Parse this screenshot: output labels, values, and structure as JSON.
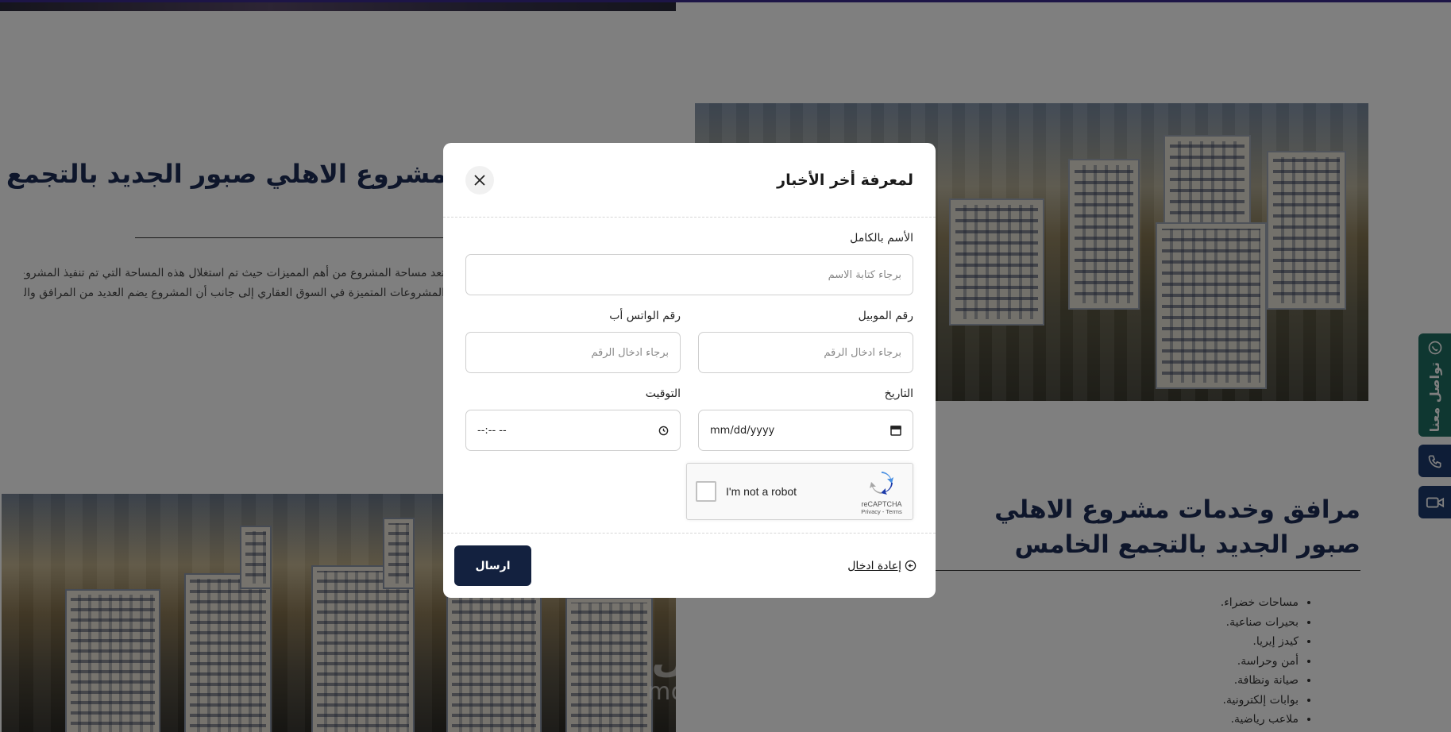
{
  "background": {
    "title_1": "مشروع الاهلي صبور الجديد بالتجمع",
    "paragraph_1_line_1": "تعد مساحة المشروع من أهم المميزات حيث تم استغلال هذه المساحة التي تم تنفيذ المشروع عليها تم استغلالها بطريقة مميزة ليكون المشروع من",
    "paragraph_1_line_2": "المشروعات المتميزة في السوق العقاري إلى جانب أن المشروع يضم العديد من المرافق والخدمات المميزة التي تستطيع من خلالها ضمان",
    "title_2": "مرافق وخدمات مشروع الاهلي صبور الجديد بالتجمع الخامس",
    "amenities": [
      "مساحات خضراء.",
      "بحيرات صناعية.",
      "كيدز إيريا.",
      "أمن وحراسة.",
      "صيانة ونظافة.",
      "بوابات إلكترونية.",
      "ملاعب رياضية."
    ],
    "side_contact_label": "تواصل معنا",
    "watermark_ar": "مستقل",
    "watermark_en": "mostaql.com"
  },
  "modal": {
    "title": "لمعرفة أخر الأخبار",
    "full_name_label": "الأسم بالكامل",
    "full_name_placeholder": "برجاء كتابة الاسم",
    "mobile_label": "رقم الموبيل",
    "mobile_placeholder": "برجاء ادخال الرقم",
    "whatsapp_label": "رقم الواتس أب",
    "whatsapp_placeholder": "برجاء ادخال الرقم",
    "date_label": "التاريخ",
    "date_value": "mm/dd/yyyy",
    "time_label": "التوقيت",
    "time_value": "--:-- --",
    "captcha_text": "I'm not a robot",
    "captcha_brand": "reCAPTCHA",
    "captcha_links": "Privacy - Terms",
    "reset_label": "إعادة ادخال",
    "submit_label": "ارسال"
  },
  "colors": {
    "navy": "#13213f",
    "title_blue": "#1c2c56",
    "whatsapp_green": "#1f6f63",
    "phone_blue": "#1c3a6e"
  }
}
